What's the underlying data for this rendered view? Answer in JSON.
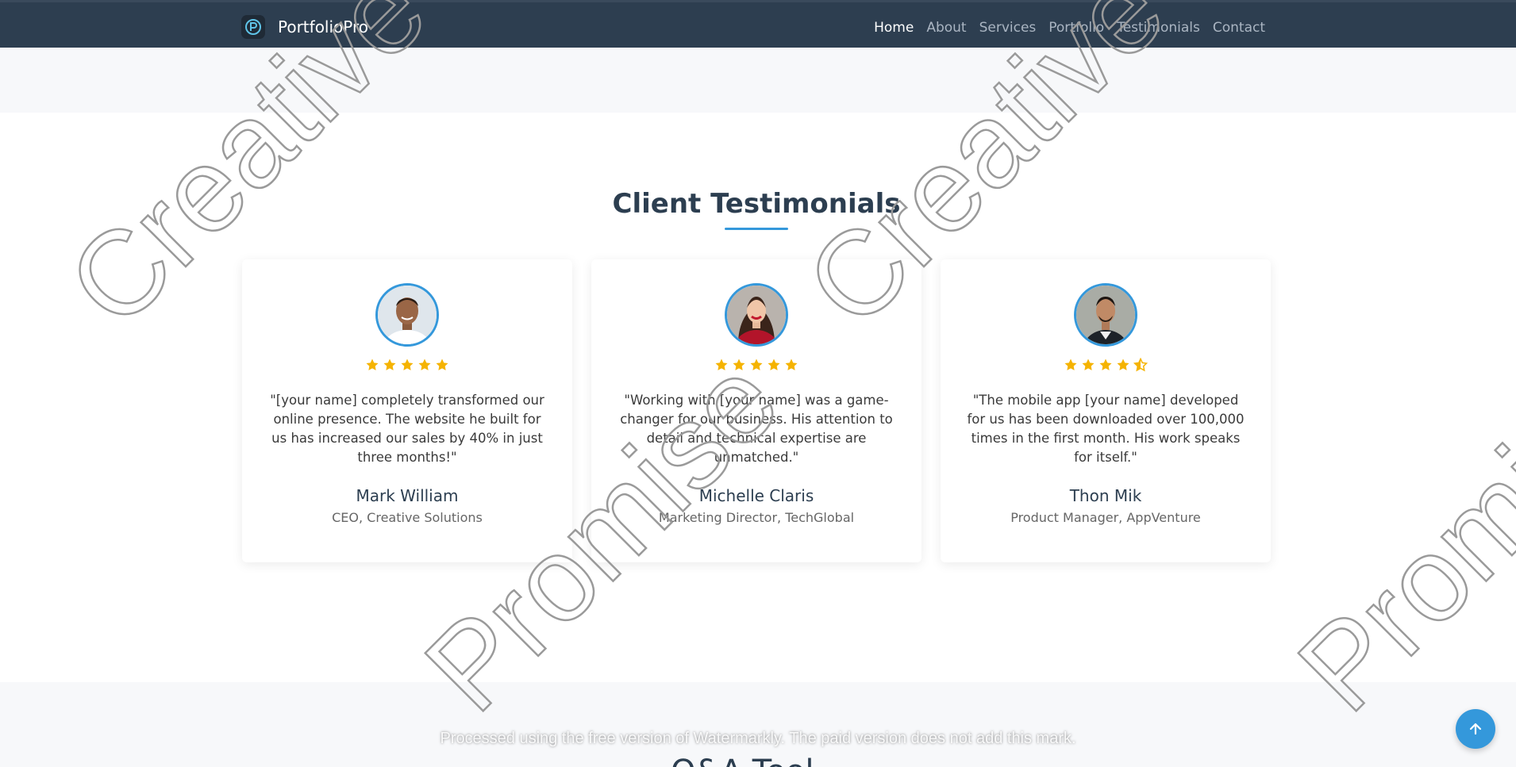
{
  "nav": {
    "brand": "PortfolioPro",
    "items": [
      {
        "label": "Home",
        "active": true
      },
      {
        "label": "About"
      },
      {
        "label": "Services"
      },
      {
        "label": "Portfolio"
      },
      {
        "label": "Testimonials"
      },
      {
        "label": "Contact"
      }
    ]
  },
  "section": {
    "title": "Client Testimonials"
  },
  "testimonials": [
    {
      "quote": "\"[your name] completely transformed our online presence. The website he built for us has increased our sales by 40% in just three months!\"",
      "name": "Mark William",
      "role": "CEO, Creative Solutions",
      "rating": 5
    },
    {
      "quote": "\"Working with [your name] was a game-changer for our business. His attention to detail and technical expertise are unmatched.\"",
      "name": "Michelle Claris",
      "role": "Marketing Director, TechGlobal",
      "rating": 5
    },
    {
      "quote": "\"The mobile app [your name] developed for us has been downloaded over 100,000 times in the first month. His work speaks for itself.\"",
      "name": "Thon Mik",
      "role": "Product Manager, AppVenture",
      "rating": 4.5
    }
  ],
  "watermark": {
    "notice": "Processed using the free version of Watermarkly. The paid version does not add this mark.",
    "word1": "Promise",
    "word2": "Creative"
  },
  "next_section": {
    "heading_partial": "Q&A Tool"
  },
  "colors": {
    "navbar": "#2d3e50",
    "accent": "#3498db",
    "star": "#f5b301"
  },
  "icons": {
    "back_to_top": "arrow-up-icon"
  }
}
